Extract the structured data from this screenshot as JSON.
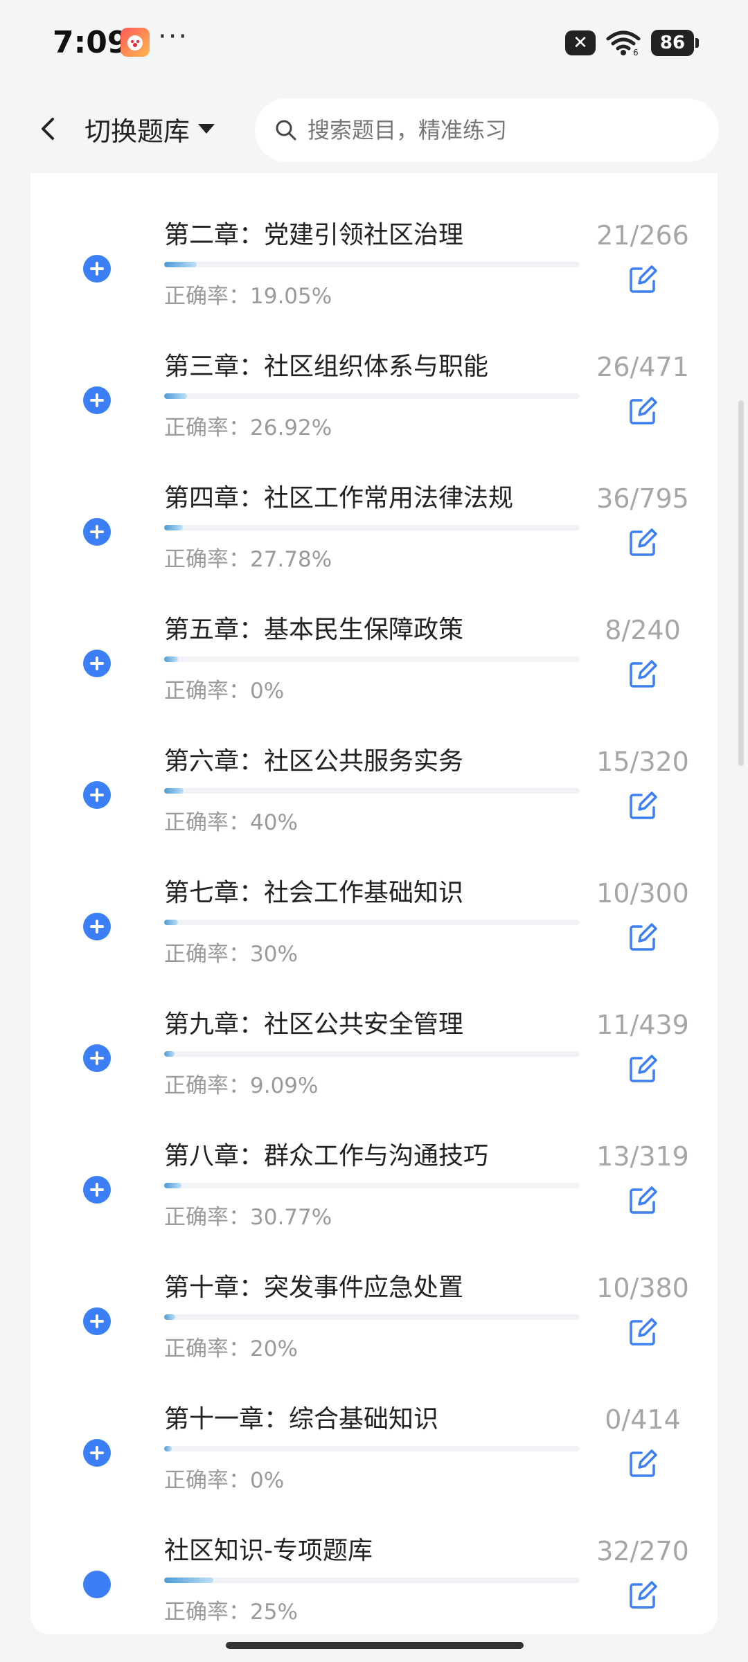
{
  "status_bar": {
    "time": "7:09",
    "app_icon_label": "",
    "overflow_dots": "···",
    "mute_symbol": "✕",
    "battery_level": "86"
  },
  "header": {
    "switch_bank_label": "切换题库",
    "search_placeholder": "搜索题目，精准练习"
  },
  "chapters": [
    {
      "title": "第二章：党建引领社区治理",
      "accuracy": "正确率：19.05%",
      "count": "21/266",
      "progress": 0.079
    },
    {
      "title": "第三章：社区组织体系与职能",
      "accuracy": "正确率：26.92%",
      "count": "26/471",
      "progress": 0.055
    },
    {
      "title": "第四章：社区工作常用法律法规",
      "accuracy": "正确率：27.78%",
      "count": "36/795",
      "progress": 0.045
    },
    {
      "title": "第五章：基本民生保障政策",
      "accuracy": "正确率：0%",
      "count": "8/240",
      "progress": 0.033
    },
    {
      "title": "第六章：社区公共服务实务",
      "accuracy": "正确率：40%",
      "count": "15/320",
      "progress": 0.047
    },
    {
      "title": "第七章：社会工作基础知识",
      "accuracy": "正确率：30%",
      "count": "10/300",
      "progress": 0.033
    },
    {
      "title": "第九章：社区公共安全管理",
      "accuracy": "正确率：9.09%",
      "count": "11/439",
      "progress": 0.025
    },
    {
      "title": "第八章：群众工作与沟通技巧",
      "accuracy": "正确率：30.77%",
      "count": "13/319",
      "progress": 0.041
    },
    {
      "title": "第十章：突发事件应急处置",
      "accuracy": "正确率：20%",
      "count": "10/380",
      "progress": 0.026
    },
    {
      "title": "第十一章：综合基础知识",
      "accuracy": "正确率：0%",
      "count": "0/414",
      "progress": 0.0
    },
    {
      "title": "社区知识-专项题库",
      "accuracy": "正确率：25%",
      "count": "32/270",
      "progress": 0.119,
      "filled_marker": true
    }
  ],
  "colors": {
    "accent": "#3b7ef6",
    "progress_start": "#4a9ad6",
    "progress_end": "#bfe0f6",
    "muted_text": "#9a9a9a"
  },
  "icons": {
    "back": "chevron-left-icon",
    "dropdown": "caret-down-icon",
    "search": "search-icon",
    "add": "plus-circle-icon",
    "edit": "edit-icon"
  }
}
